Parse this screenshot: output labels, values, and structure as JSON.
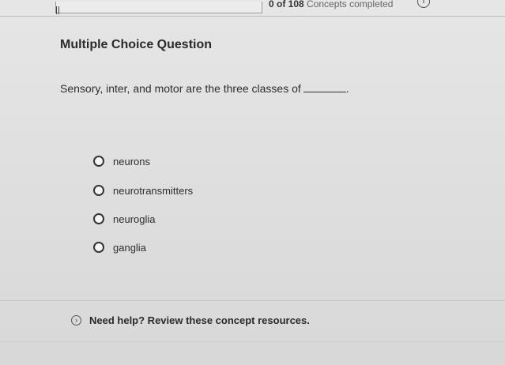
{
  "progress": {
    "text_prefix": "0 of 108",
    "text_suffix": "Concepts completed",
    "completed": 0,
    "total": 108,
    "fraction": 0,
    "info_icon_glyph": "i"
  },
  "question": {
    "heading": "Multiple Choice Question",
    "prompt_before_blank": "Sensory, inter, and motor are the three classes of",
    "prompt_after_blank": "."
  },
  "choices": [
    {
      "label": "neurons"
    },
    {
      "label": "neurotransmitters"
    },
    {
      "label": "neuroglia"
    },
    {
      "label": "ganglia"
    }
  ],
  "help": {
    "icon_glyph": "›",
    "text": "Need help? Review these concept resources."
  },
  "colors": {
    "background": "#e3e3e3",
    "text": "#2b2b2b",
    "progress_fill": "#4a6fa5"
  }
}
